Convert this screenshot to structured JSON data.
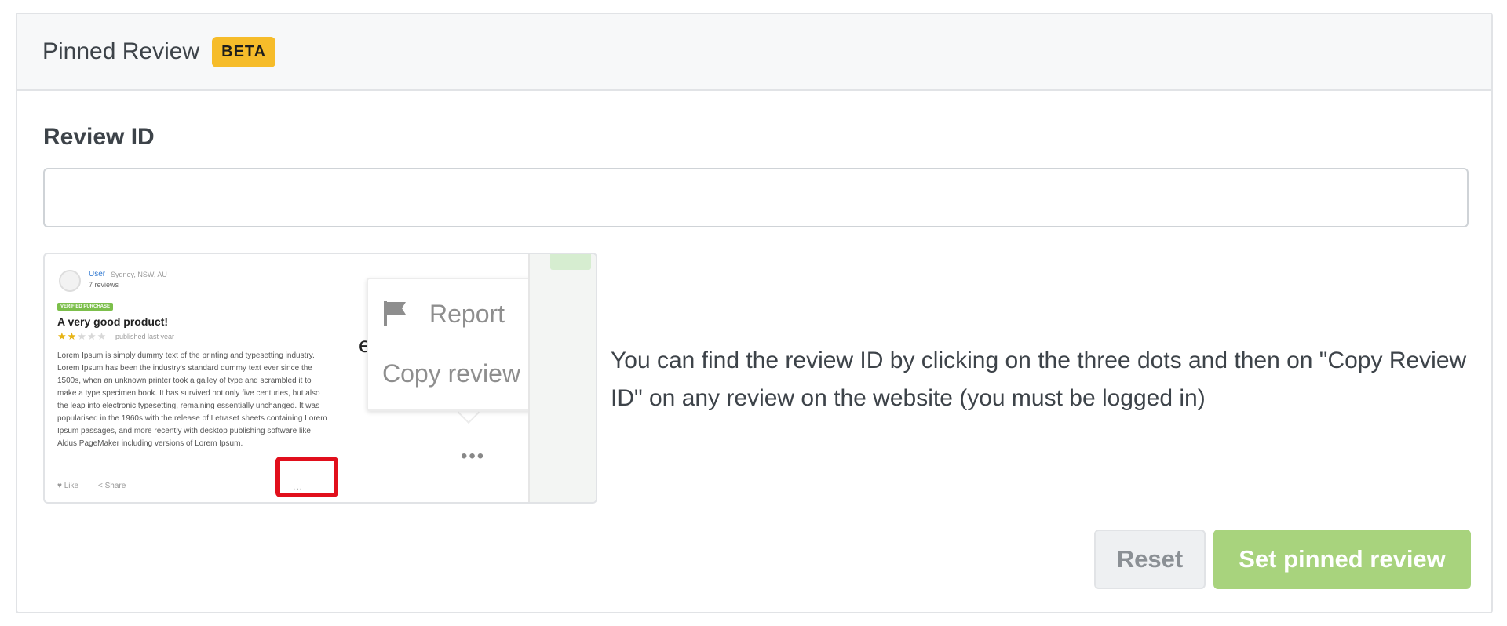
{
  "card": {
    "title": "Pinned Review",
    "badge": "BETA"
  },
  "field": {
    "label": "Review ID",
    "value": "",
    "placeholder": ""
  },
  "help": {
    "text": "You can find the review ID by clicking on the three dots and then on \"Copy Review ID\" on any review on the website (you must be logged in)"
  },
  "illustration": {
    "user": "User",
    "location": "Sydney, NSW, AU",
    "review_count": "7 reviews",
    "verified": "VERIFIED PURCHASE",
    "review_title": "A very good product!",
    "stars_filled": "★★",
    "stars_empty": "★★★",
    "published": "published last year",
    "body": "Lorem Ipsum is simply dummy text of the printing and typesetting industry. Lorem Ipsum has been the industry's standard dummy text ever since the 1500s, when an unknown printer took a galley of type and scrambled it to make a type specimen book. It has survived not only five centuries, but also the leap into electronic typesetting, remaining essentially unchanged. It was popularised in the 1960s with the release of Letraset sheets containing Lorem Ipsum passages, and more recently with desktop publishing software like Aldus PageMaker including versions of Lorem Ipsum.",
    "like": "♥ Like",
    "share": "< Share",
    "dots_small": "...",
    "partial_letter": "e",
    "menu_report": "Report",
    "menu_copy": "Copy review ID",
    "dots_big": "•••"
  },
  "buttons": {
    "reset": "Reset",
    "set": "Set pinned review"
  },
  "colors": {
    "badge": "#f6bc2a",
    "primary_button": "#a8d37d",
    "highlight": "#e10f1c",
    "verified": "#7cbf4b"
  }
}
